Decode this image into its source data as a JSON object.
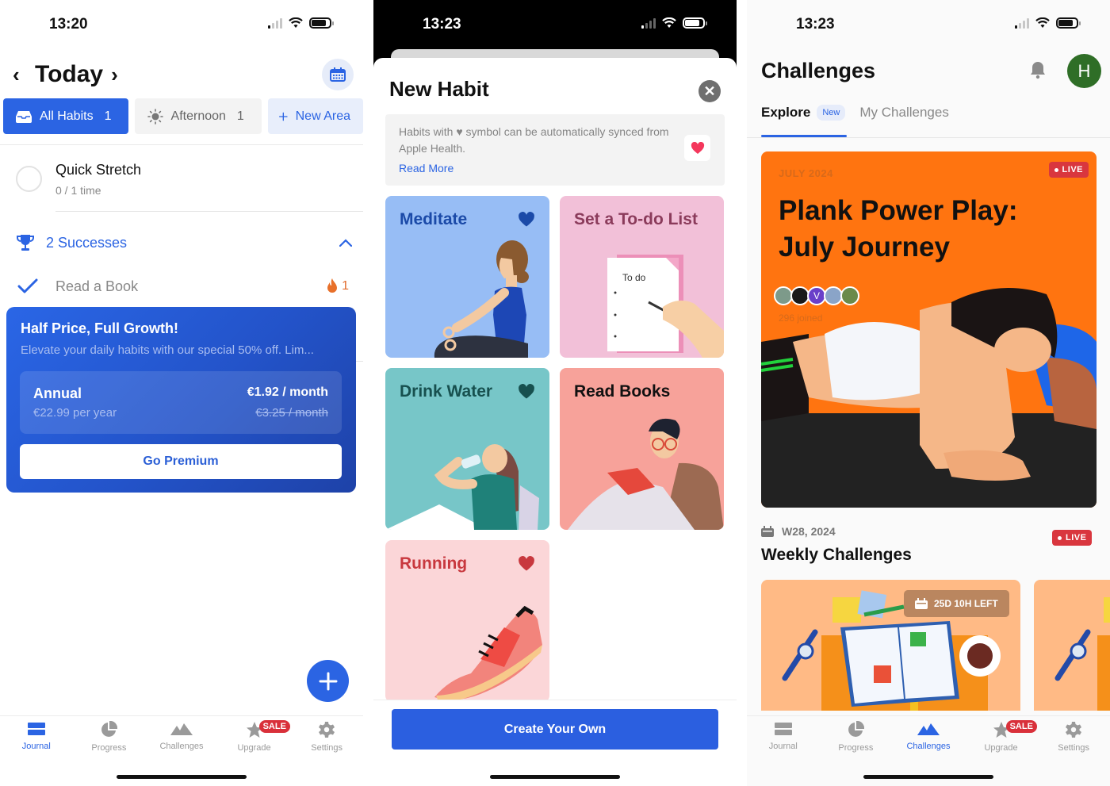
{
  "screens": [
    {
      "status": {
        "time": "13:20"
      },
      "header": {
        "title": "Today",
        "prev_icon": "chevron-left-icon",
        "next_icon": "chevron-right-icon",
        "calendar_icon": "calendar-icon"
      },
      "areas": [
        {
          "label": "All Habits",
          "count": "1",
          "icon": "inbox-icon",
          "active": true
        },
        {
          "label": "Afternoon",
          "count": "1",
          "icon": "sun-icon",
          "active": false
        },
        {
          "label": "New Area",
          "icon": "plus-icon",
          "active": false
        }
      ],
      "habits": [
        {
          "name": "Quick Stretch",
          "progress": "0 / 1 time"
        }
      ],
      "successes": {
        "label": "2 Successes",
        "icon": "trophy-icon",
        "expanded": true
      },
      "completed": [
        {
          "name": "Read a Book",
          "streak": "1",
          "streak_icon": "flame-icon"
        }
      ],
      "promo": {
        "title": "Half Price, Full Growth!",
        "subtitle": "Elevate your daily habits with our special 50% off. Lim...",
        "plan_name": "Annual",
        "plan_year_price": "€22.99 per year",
        "plan_month_price": "€1.92 / month",
        "plan_old_price": "€3.25 / month",
        "cta": "Go Premium"
      },
      "fab_icon": "plus-icon"
    },
    {
      "status": {
        "time": "13:23"
      },
      "sheet": {
        "title": "New Habit",
        "info_text": "Habits with ♥ symbol can be automatically synced from Apple Health.",
        "read_more": "Read More",
        "habits": [
          {
            "title": "Meditate",
            "health": true,
            "bg": "#97bdf5",
            "fg": "#1b4aa8"
          },
          {
            "title": "Set a To-do List",
            "health": false,
            "bg": "#f2c0d8",
            "fg": "#8b3b5b",
            "note": "To do"
          },
          {
            "title": "Drink Water",
            "health": true,
            "bg": "#77c6c8",
            "fg": "#17504f"
          },
          {
            "title": "Read Books",
            "health": false,
            "bg": "#f7a29a",
            "fg": "#111111"
          },
          {
            "title": "Running",
            "health": true,
            "bg": "#fbd6d8",
            "fg": "#c8383e"
          }
        ],
        "create_button": "Create Your Own"
      }
    },
    {
      "status": {
        "time": "13:23"
      },
      "header": {
        "title": "Challenges",
        "avatar_initial": "H"
      },
      "tabs": [
        {
          "label": "Explore",
          "badge": "New",
          "active": true
        },
        {
          "label": "My Challenges",
          "active": false
        }
      ],
      "featured": {
        "month": "JULY 2024",
        "title": "Plank Power Play: July Journey",
        "live": "LIVE",
        "joined": "296 joined",
        "avatar_initial": "V"
      },
      "weekly": {
        "date": "W28, 2024",
        "title": "Weekly Challenges",
        "live": "LIVE",
        "time_left": "25D 10H LEFT"
      }
    }
  ],
  "tabbar": [
    {
      "label": "Journal",
      "icon": "journal-icon"
    },
    {
      "label": "Progress",
      "icon": "pie-chart-icon"
    },
    {
      "label": "Challenges",
      "icon": "mountains-icon"
    },
    {
      "label": "Upgrade",
      "icon": "star-icon",
      "badge": "SALE"
    },
    {
      "label": "Settings",
      "icon": "gear-icon"
    }
  ],
  "colors": {
    "accent": "#2b64e3",
    "sale": "#d9303a",
    "featured_bg": "#ff7410",
    "avatar": "#2f6e27"
  }
}
